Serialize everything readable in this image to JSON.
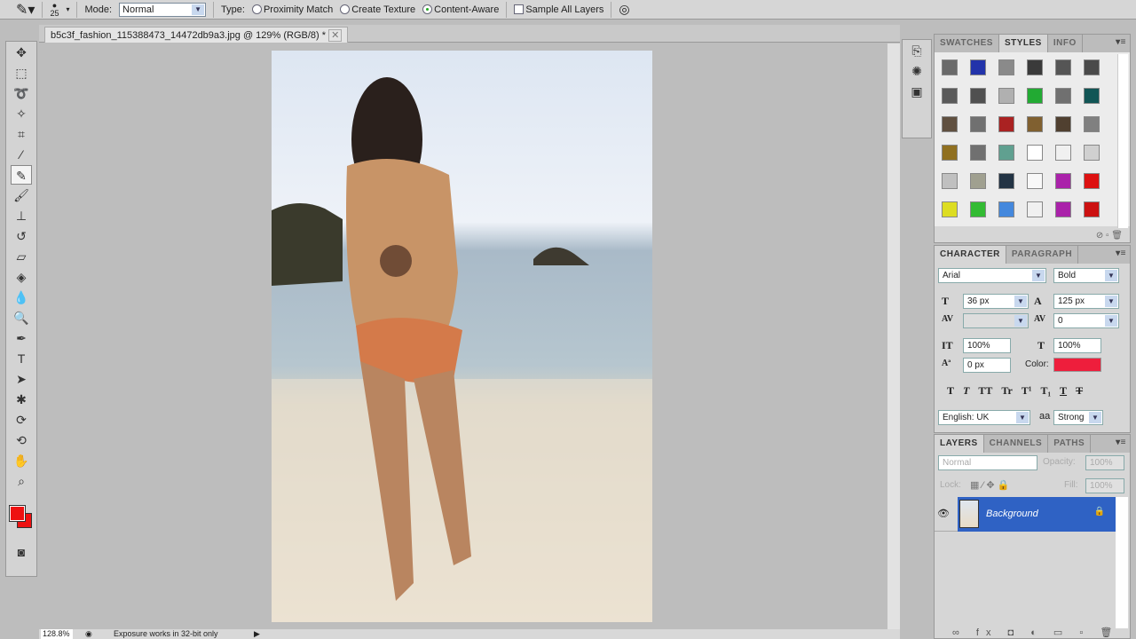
{
  "options": {
    "brush_size": "25",
    "mode_label": "Mode:",
    "mode_value": "Normal",
    "type_label": "Type:",
    "types": [
      "Proximity Match",
      "Create Texture",
      "Content-Aware"
    ],
    "selected_type": "Content-Aware",
    "sample_all_layers": "Sample All Layers"
  },
  "document": {
    "tab_title": "b5c3f_fashion_115388473_14472db9a3.jpg @ 129% (RGB/8) *",
    "zoom": "128.8%",
    "status_message": "Exposure works in 32-bit only"
  },
  "styles_panel": {
    "tabs": [
      "SWATCHES",
      "STYLES",
      "INFO"
    ],
    "active": "STYLES",
    "swatches": [
      "#6a6a6a",
      "#2233aa",
      "#8a8a8a",
      "#3a3a3a",
      "#555555",
      "#4a4a4a",
      "#5a5a5a",
      "#505050",
      "#b0b0b0",
      "#22aa33",
      "#707070",
      "#115555",
      "#605040",
      "#707070",
      "#aa2222",
      "#806030",
      "#504030",
      "#808080",
      "#907020",
      "#707070",
      "#60a090",
      "#ffffff",
      "#f0f0f0",
      "#d0d0d0",
      "#c0c0c0",
      "#a0a090",
      "#223344",
      "#f8f8f8",
      "#aa22aa",
      "#dd1111",
      "#dddd22",
      "#33bb33",
      "#4488dd",
      "#f0f0f0",
      "#aa22aa",
      "#cc1111"
    ]
  },
  "character_panel": {
    "tabs": [
      "CHARACTER",
      "PARAGRAPH"
    ],
    "font_family": "Arial",
    "font_style": "Bold",
    "font_size": "36 px",
    "leading": "125 px",
    "kerning": "",
    "tracking": "0",
    "vertical_scale": "100%",
    "horizontal_scale": "100%",
    "baseline_shift": "0 px",
    "color_label": "Color:",
    "color": "#ee1e3c",
    "style_buttons": [
      "T",
      "T",
      "TT",
      "Tr",
      "T¹",
      "T₁",
      "T",
      "T"
    ],
    "language": "English: UK",
    "aa_label": "aa",
    "antialias": "Strong"
  },
  "layers_panel": {
    "tabs": [
      "LAYERS",
      "CHANNELS",
      "PATHS"
    ],
    "blend_mode": "Normal",
    "opacity_label": "Opacity:",
    "opacity": "100%",
    "lock_label": "Lock:",
    "fill_label": "Fill:",
    "fill": "100%",
    "layers": [
      {
        "name": "Background",
        "visible": true,
        "locked": true,
        "selected": true
      }
    ]
  },
  "colors": {
    "foreground": "#ee1111",
    "background": "#ee1111",
    "selection": "#2f62c4"
  }
}
